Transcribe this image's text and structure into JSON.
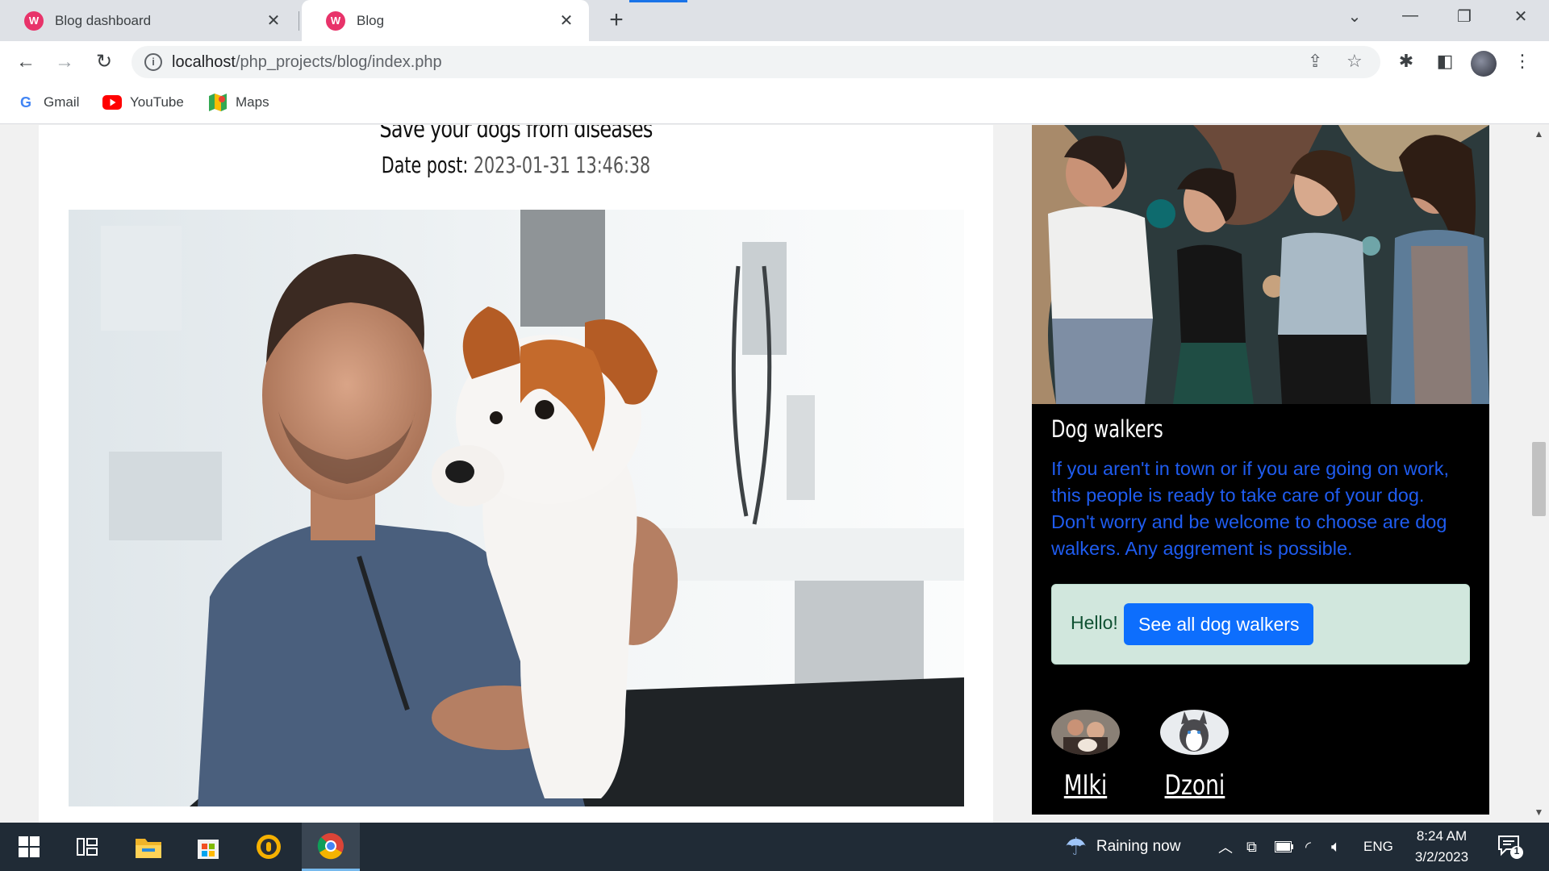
{
  "browser": {
    "tabs": [
      {
        "title": "Blog dashboard",
        "active": false
      },
      {
        "title": "Blog",
        "active": true
      }
    ],
    "url_host": "localhost",
    "url_path": "/php_projects/blog/index.php",
    "bookmarks": [
      {
        "label": "Gmail",
        "icon": "google-icon"
      },
      {
        "label": "YouTube",
        "icon": "youtube-icon"
      },
      {
        "label": "Maps",
        "icon": "maps-icon"
      }
    ]
  },
  "post": {
    "title": "Save your dogs from diseases",
    "date_label": "Date post:",
    "date_value": "2023-01-31 13:46:38",
    "image_icon": "vet-with-dog-photo"
  },
  "sidebar": {
    "heading": "Dog walkers",
    "description": "If you aren't in town or if you are going on work, this people is ready to take care of your dog. Don't worry and be welcome to choose are dog walkers. Any aggrement is possible.",
    "alert_text": "Hello!",
    "button_label": "See all dog walkers",
    "walkers": [
      {
        "name": "MIki"
      },
      {
        "name": "Dzoni"
      }
    ]
  },
  "taskbar": {
    "weather": "Raining now",
    "language": "ENG",
    "time": "8:24 AM",
    "date": "3/2/2023",
    "notification_count": "1"
  },
  "colors": {
    "accent_blue": "#0d6efd",
    "sidebar_text": "#1f5cf0",
    "alert_bg": "#d1e7dd",
    "taskbar_bg": "#202b36"
  }
}
